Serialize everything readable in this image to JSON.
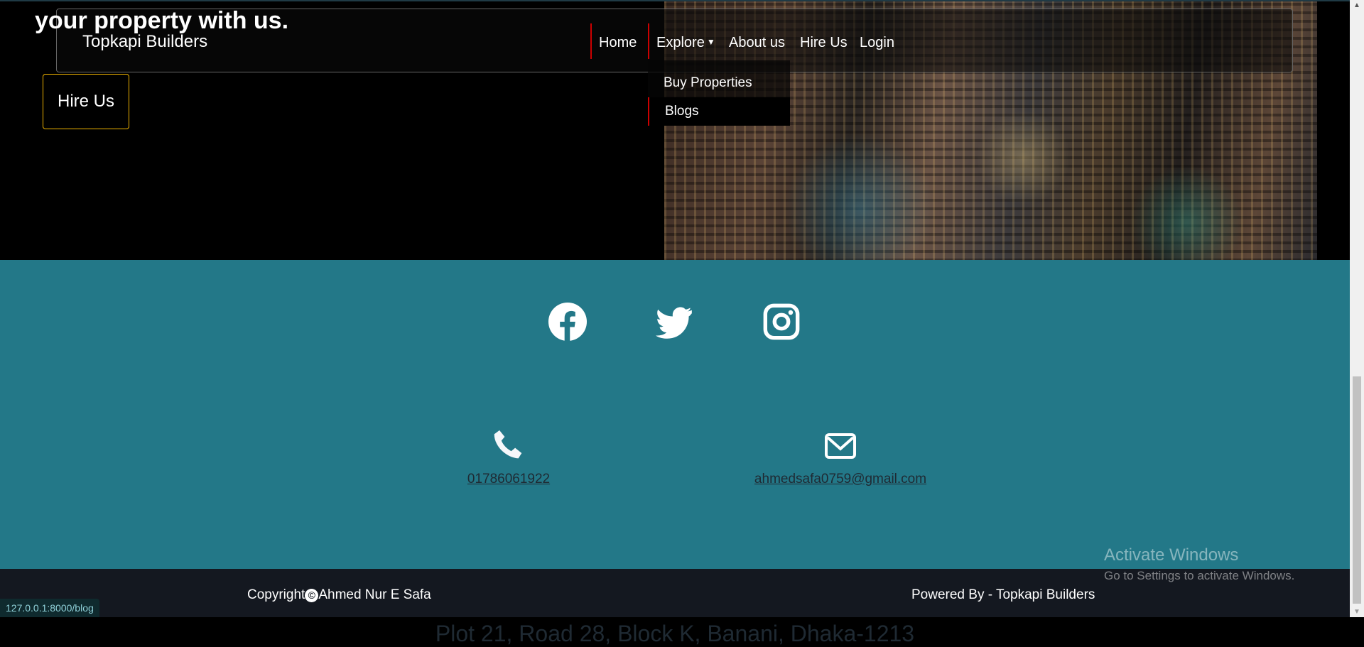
{
  "hero": {
    "headline_fragment": "your property with us.",
    "hire_button": "Hire Us"
  },
  "navbar": {
    "brand": "Topkapi Builders",
    "items": [
      "Home",
      "Explore",
      "About us",
      "Hire Us",
      "Login"
    ],
    "dropdown": [
      "Buy Properties",
      "Blogs"
    ]
  },
  "contact": {
    "social": [
      "facebook-icon",
      "twitter-icon",
      "instagram-icon"
    ],
    "address": "Plot 21, Road 28, Block K, Banani, Dhaka-1213",
    "phone": "01786061922",
    "email": "ahmedsafa0759@gmail.com"
  },
  "footer": {
    "copyright_prefix": "Copyright",
    "copyright_symbol": "©",
    "copyright_name": "Ahmed Nur E Safa",
    "powered": "Powered By - Topkapi Builders"
  },
  "watermark": {
    "title": "Activate Windows",
    "subtitle": "Go to Settings to activate Windows."
  },
  "status_url": "127.0.0.1:8000/blog",
  "colors": {
    "teal": "#237888",
    "footer": "#141820",
    "accent_red": "#cc0000",
    "button_border": "#f0b400"
  }
}
